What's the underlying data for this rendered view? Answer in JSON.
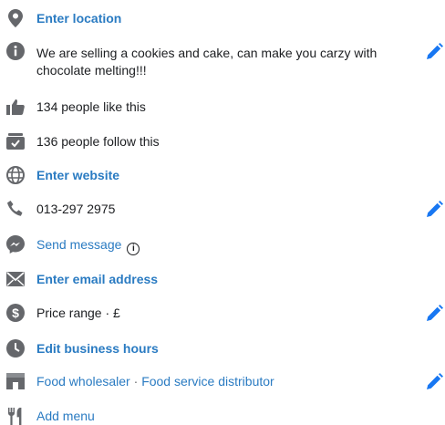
{
  "about": {
    "location": {
      "label": "Enter location",
      "icon": "location-pin-icon"
    },
    "description": {
      "text": "We are selling a cookies and cake, can make you carzy with chocolate melting!!!",
      "icon": "info-icon"
    },
    "likes": {
      "text": "134 people like this",
      "icon": "thumbs-up-icon"
    },
    "follows": {
      "text": "136 people follow this",
      "icon": "follow-check-icon"
    },
    "website": {
      "label": "Enter website",
      "icon": "globe-icon"
    },
    "phone": {
      "text": "013-297 2975",
      "icon": "phone-icon"
    },
    "message": {
      "label": "Send message",
      "info_glyph": "i",
      "icon": "messenger-icon"
    },
    "email": {
      "label": "Enter email address",
      "icon": "mail-icon"
    },
    "price": {
      "text": "Price range · £",
      "icon": "dollar-icon"
    },
    "hours": {
      "label": "Edit business hours",
      "icon": "clock-icon"
    },
    "categories": {
      "items": [
        "Food wholesaler",
        "Food service distributor"
      ],
      "separator": "·",
      "icon": "storefront-icon"
    },
    "menu": {
      "label": "Add menu",
      "icon": "fork-knife-icon"
    }
  },
  "colors": {
    "link": "#2a7bc2",
    "text": "#1c1e21",
    "icon": "#65676b",
    "edit_pencil": "#1877f2"
  }
}
